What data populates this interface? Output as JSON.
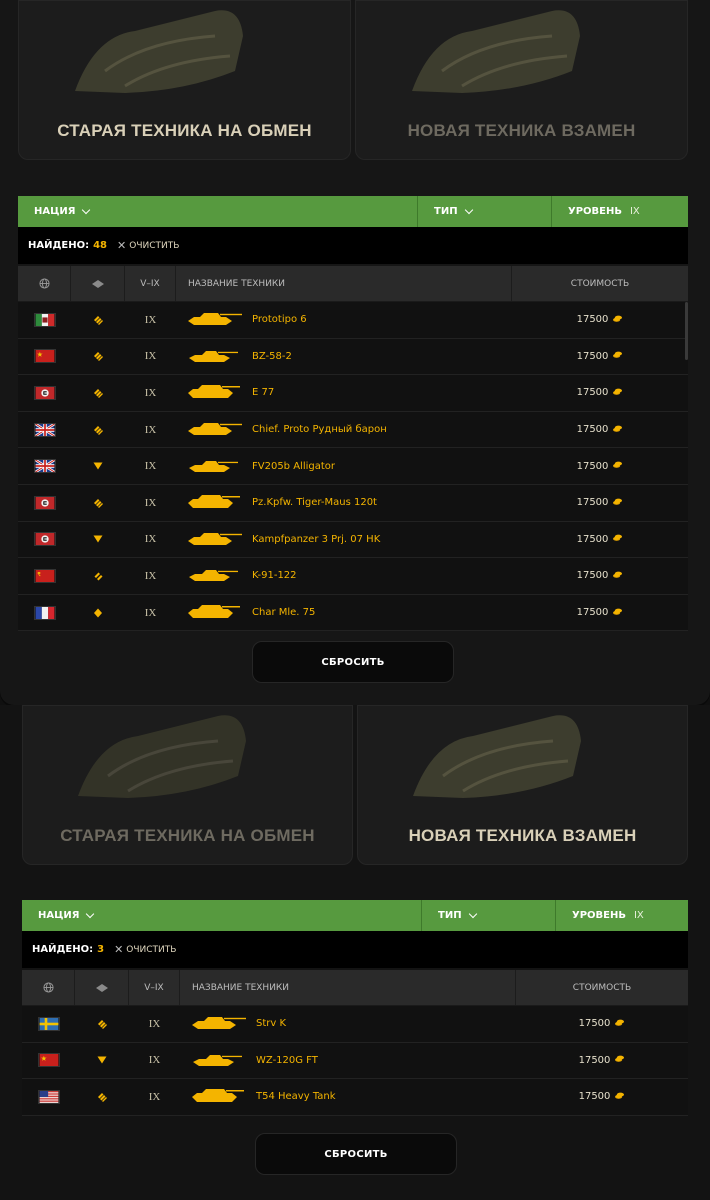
{
  "section1": {
    "card_old": "СТАРАЯ ТЕХНИКА НА ОБМЕН",
    "card_new": "НОВАЯ ТЕХНИКА ВЗАМЕН",
    "filter": {
      "nation": "НАЦИЯ",
      "type": "ТИП",
      "level": "УРОВЕНЬ",
      "level_value": "IX"
    },
    "found_label": "НАЙДЕНО:",
    "found_count": "48",
    "clear_label": "ОЧИСТИТЬ",
    "header": {
      "tier": "V–IX",
      "name": "НАЗВАНИЕ ТЕХНИКИ",
      "cost": "СТОИМОСТЬ"
    },
    "rows": [
      {
        "flag": "italy",
        "class": "heavy",
        "tier": "IX",
        "name": "Prototipo 6",
        "cost": "17500"
      },
      {
        "flag": "china",
        "class": "heavy",
        "tier": "IX",
        "name": "BZ-58-2",
        "cost": "17500"
      },
      {
        "flag": "germany",
        "class": "heavy",
        "tier": "IX",
        "name": "E 77",
        "cost": "17500"
      },
      {
        "flag": "uk",
        "class": "heavy",
        "tier": "IX",
        "name": "Chief. Proto Рудный барон",
        "cost": "17500"
      },
      {
        "flag": "uk",
        "class": "td",
        "tier": "IX",
        "name": "FV205b Alligator",
        "cost": "17500"
      },
      {
        "flag": "germany",
        "class": "heavy",
        "tier": "IX",
        "name": "Pz.Kpfw. Tiger-Maus 120t",
        "cost": "17500"
      },
      {
        "flag": "germany",
        "class": "td",
        "tier": "IX",
        "name": "Kampfpanzer 3 Prj. 07 HK",
        "cost": "17500"
      },
      {
        "flag": "ussr",
        "class": "medium",
        "tier": "IX",
        "name": "K-91-122",
        "cost": "17500"
      },
      {
        "flag": "france",
        "class": "light",
        "tier": "IX",
        "name": "Char Mle. 75",
        "cost": "17500"
      }
    ],
    "reset_label": "СБРОСИТЬ"
  },
  "section2": {
    "card_old": "СТАРАЯ ТЕХНИКА НА ОБМЕН",
    "card_new": "НОВАЯ ТЕХНИКА ВЗАМЕН",
    "filter": {
      "nation": "НАЦИЯ",
      "type": "ТИП",
      "level": "УРОВЕНЬ",
      "level_value": "IX"
    },
    "found_label": "НАЙДЕНО:",
    "found_count": "3",
    "clear_label": "ОЧИСТИТЬ",
    "header": {
      "tier": "V–IX",
      "name": "НАЗВАНИЕ ТЕХНИКИ",
      "cost": "СТОИМОСТЬ"
    },
    "rows": [
      {
        "flag": "sweden",
        "class": "heavy",
        "tier": "IX",
        "name": "Strv K",
        "cost": "17500"
      },
      {
        "flag": "china",
        "class": "td",
        "tier": "IX",
        "name": "WZ-120G FT",
        "cost": "17500"
      },
      {
        "flag": "usa",
        "class": "heavy",
        "tier": "IX",
        "name": "T54 Heavy Tank",
        "cost": "17500"
      }
    ],
    "reset_label": "СБРОСИТЬ"
  },
  "colors": {
    "accent_green": "#579a3f",
    "gold": "#f4b400",
    "background": "#161616"
  }
}
